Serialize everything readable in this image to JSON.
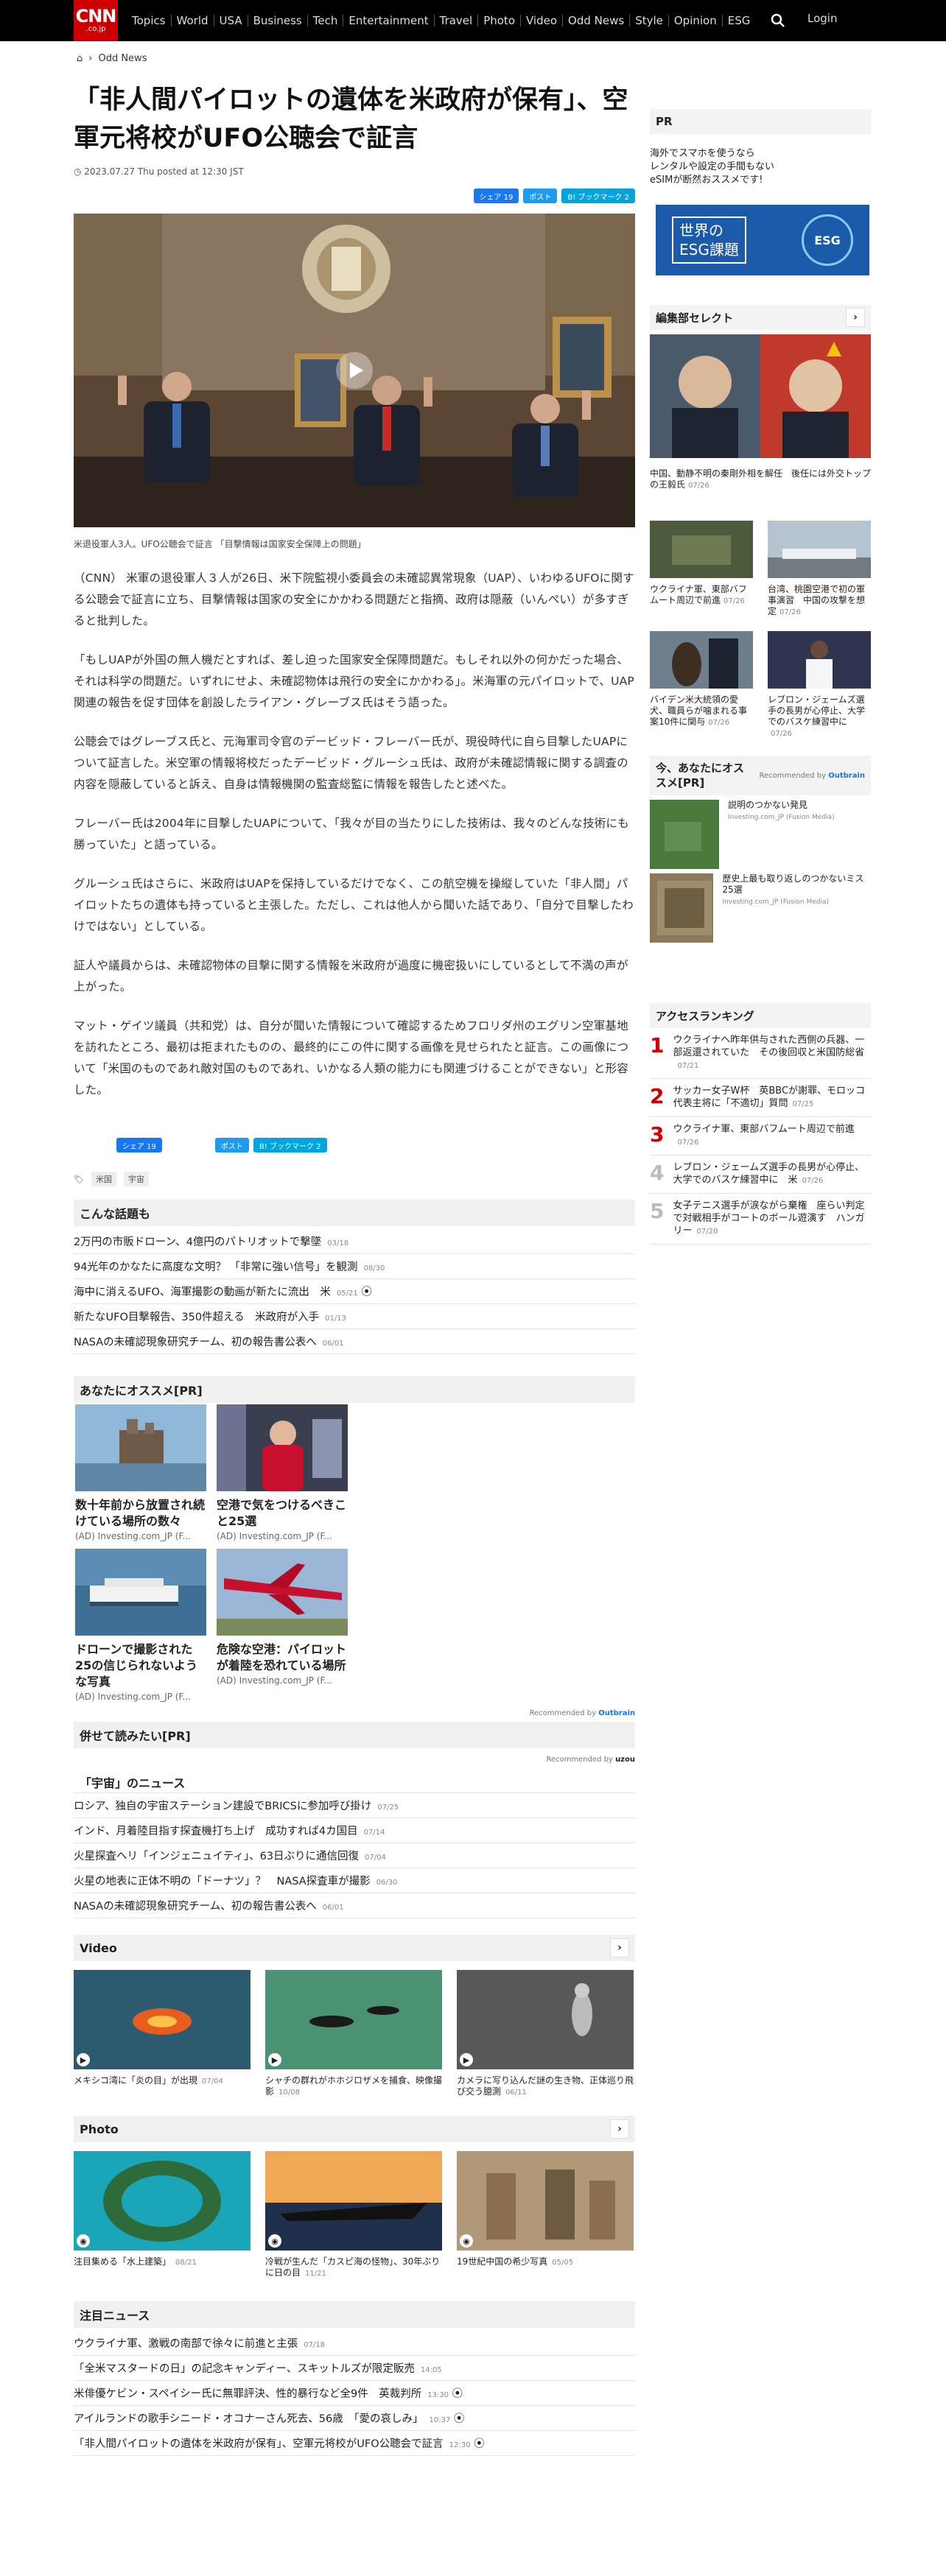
{
  "header": {
    "logo_main": "CNN",
    "logo_sub": ".co.jp",
    "nav": [
      "Topics",
      "World",
      "USA",
      "Business",
      "Tech",
      "Entertainment",
      "Travel",
      "Photo",
      "Video",
      "Odd News",
      "Style",
      "Opinion",
      "ESG"
    ],
    "login": "Login"
  },
  "breadcrumb": {
    "home": "⌂",
    "sep": "›",
    "current": "Odd News"
  },
  "article": {
    "title": "「非人間パイロットの遺体を米政府が保有」、空軍元将校がUFO公聴会で証言",
    "date": "2023.07.27 Thu posted at 12:30 JST",
    "share": {
      "fb": "シェア 19",
      "tw": "ポスト",
      "hb": "B! ブックマーク 2"
    },
    "caption": "米退役軍人3人。UFO公聴会で証言 「目撃情報は国家安全保障上の問題」",
    "paragraphs": [
      "（CNN） 米軍の退役軍人３人が26日、米下院監視小委員会の未確認異常現象（UAP）、いわゆるUFOに関する公聴会で証言に立ち、目撃情報は国家の安全にかかわる問題だと指摘、政府は隠蔽（いんぺい）が多すぎると批判した。",
      "「もしUAPが外国の無人機だとすれば、差し迫った国家安全保障問題だ。もしそれ以外の何かだった場合、それは科学の問題だ。いずれにせよ、未確認物体は飛行の安全にかかわる」。米海軍の元パイロットで、UAP関連の報告を促す団体を創設したライアン・グレーブス氏はそう語った。",
      "公聴会ではグレーブス氏と、元海軍司令官のデービッド・フレーバー氏が、現役時代に自ら目撃したUAPについて証言した。米空軍の情報将校だったデービッド・グルーシュ氏は、政府が未確認情報に関する調査の内容を隠蔽していると訴え、自身は情報機関の監査総監に情報を報告したと述べた。",
      "フレーバー氏は2004年に目撃したUAPについて、「我々が目の当たりにした技術は、我々のどんな技術にも勝っていた」と語っている。",
      "グルーシュ氏はさらに、米政府はUAPを保持しているだけでなく、この航空機を操縦していた「非人間」パイロットたちの遺体も持っていると主張した。ただし、これは他人から聞いた話であり、「自分で目撃したわけではない」としている。",
      "証人や議員からは、未確認物体の目撃に関する情報を米政府が過度に機密扱いにしているとして不満の声が上がった。",
      "マット・ゲイツ議員（共和党）は、自分が聞いた情報について確認するためフロリダ州のエグリン空軍基地を訪れたところ、最初は拒まれたものの、最終的にこの件に関する画像を見せられたと証言。この画像について「米国のものであれ敵対国のものであれ、いかなる人類の能力にも関連づけることができない」と形容した。"
    ],
    "share2": {
      "fb": "シェア 19",
      "tw": "ポスト",
      "hb": "B! ブックマーク 2"
    },
    "tags": [
      "米国",
      "宇宙"
    ]
  },
  "related": {
    "heading": "こんな話題も",
    "items": [
      {
        "t": "2万円の市販ドローン、4億円のパトリオットで撃墜",
        "d": "03/18"
      },
      {
        "t": "94光年のかなたに高度な文明？ 「非常に強い信号」を観測",
        "d": "08/30"
      },
      {
        "t": "海中に消えるUFO、海軍撮影の動画が新たに流出　米",
        "d": "05/21"
      },
      {
        "t": "新たなUFO目撃報告、350件超える　米政府が入手",
        "d": "01/13"
      },
      {
        "t": "NASAの未確認現象研究チーム、初の報告書公表へ",
        "d": "06/01"
      }
    ]
  },
  "recommend": {
    "heading": "あなたにオススメ[PR]",
    "items": [
      {
        "t": "数十年前から放置され続けている場所の数々",
        "s": "(AD) Investing.com_JP (F..."
      },
      {
        "t": "空港で気をつけるべきこと25選",
        "s": "(AD) Investing.com_JP (F..."
      },
      {
        "t": "ドローンで撮影された25の信じられないような写真",
        "s": "(AD) Investing.com_JP (F..."
      },
      {
        "t": "危険な空港：パイロットが着陸を恐れている場所",
        "s": "(AD) Investing.com_JP (F..."
      }
    ],
    "by": "Recommended by",
    "brand": "Outbrain"
  },
  "alsoread": {
    "heading": "併せて読みたい[PR]",
    "by": "Recommended by",
    "brand": "uzou"
  },
  "space_news": {
    "heading": "「宇宙」のニュース",
    "items": [
      {
        "t": "ロシア、独自の宇宙ステーション建設でBRICSに参加呼び掛け",
        "d": "07/25"
      },
      {
        "t": "インド、月着陸目指す探査機打ち上げ　成功すれば4カ国目",
        "d": "07/14"
      },
      {
        "t": "火星探査ヘリ「インジェニュイティ」、63日ぶりに通信回復",
        "d": "07/04"
      },
      {
        "t": "火星の地表に正体不明の「ドーナツ」？　NASA探査車が撮影",
        "d": "06/30"
      },
      {
        "t": "NASAの未確認現象研究チーム、初の報告書公表へ",
        "d": "06/01"
      }
    ]
  },
  "video": {
    "heading": "Video",
    "items": [
      {
        "t": "メキシコ湾に「炎の目」が出現",
        "d": "07/04"
      },
      {
        "t": "シャチの群れがホホジロザメを捕食、映像撮影",
        "d": "10/08"
      },
      {
        "t": "カメラに写り込んだ謎の生き物、正体巡り飛び交う臆測",
        "d": "06/11"
      }
    ]
  },
  "photo": {
    "heading": "Photo",
    "items": [
      {
        "t": "注目集める「水上建築」",
        "d": "08/21"
      },
      {
        "t": "冷戦が生んだ「カスピ海の怪物」、30年ぶりに日の目",
        "d": "11/21"
      },
      {
        "t": "19世紀中国の希少写真",
        "d": "05/05"
      }
    ]
  },
  "featured": {
    "heading": "注目ニュース",
    "items": [
      {
        "t": "ウクライナ軍、激戦の南部で徐々に前進と主張",
        "d": "07/18"
      },
      {
        "t": "「全米マスタードの日」の記念キャンディー、スキットルズが限定販売",
        "d": "14:05"
      },
      {
        "t": "米俳優ケビン・スペイシー氏に無罪評決、性的暴行など全9件　英裁判所",
        "d": "13:30"
      },
      {
        "t": "アイルランドの歌手シニード・オコナーさん死去、56歳　「愛の哀しみ」",
        "d": "10:37"
      },
      {
        "t": "「非人間パイロットの遺体を米政府が保有」、空軍元将校がUFO公聴会で証言",
        "d": "12:30"
      }
    ]
  },
  "sidebar": {
    "pr_heading": "PR",
    "pr_text": "海外でスマホを使うなら\nレンタルや設定の手間もない\neSIMが断然おススメです!",
    "esg_banner": {
      "left": "世界の\nESG課題",
      "right": "ESG"
    },
    "editor_heading": "編集部セレクト",
    "editor_main": {
      "t": "中国、動静不明の秦剛外相を解任　後任には外交トップの王毅氏",
      "d": "07/26"
    },
    "editor_small": [
      {
        "t": "ウクライナ軍、東部バフムート周辺で前進",
        "d": "07/26"
      },
      {
        "t": "台湾、桃園空港で初の軍事演習　中国の攻撃を想定",
        "d": "07/26"
      },
      {
        "t": "バイデン米大統領の愛犬、職員らが噛まれる事案10件に関与",
        "d": "07/26"
      },
      {
        "t": "レブロン・ジェームズ選手の長男が心停止、大学でのバスケ練習中に",
        "d": "07/26"
      }
    ],
    "ob_heading": "今、あなたにオススメ[PR]",
    "ob_by": "Recommended by",
    "ob_brand": "Outbrain",
    "ob_items": [
      {
        "t": "説明のつかない発見",
        "s": "Investing.com_JP (Fusion Media)"
      },
      {
        "t": "歴史上最も取り返しのつかないミス25選",
        "s": "Investing.com_JP (Fusion Media)"
      }
    ],
    "rank_heading": "アクセスランキング",
    "ranks": [
      {
        "n": "1",
        "t": "ウクライナへ昨年供与された西側の兵器、一部返還されていた　その後回収と米国防総省",
        "d": "07/21"
      },
      {
        "n": "2",
        "t": "サッカー女子W杯　英BBCが謝罪、モロッコ代表主将に「不適切」質問",
        "d": "07/25"
      },
      {
        "n": "3",
        "t": "ウクライナ軍、東部バフムート周辺で前進",
        "d": "07/26"
      },
      {
        "n": "4",
        "t": "レブロン・ジェームズ選手の長男が心停止、大学でのバスケ練習中に　米",
        "d": "07/26"
      },
      {
        "n": "5",
        "t": "女子テニス選手が涙ながら棄権　座らい判定で対戦相手がコートのボール遊演す　ハンガリー",
        "d": "07/20"
      }
    ]
  }
}
